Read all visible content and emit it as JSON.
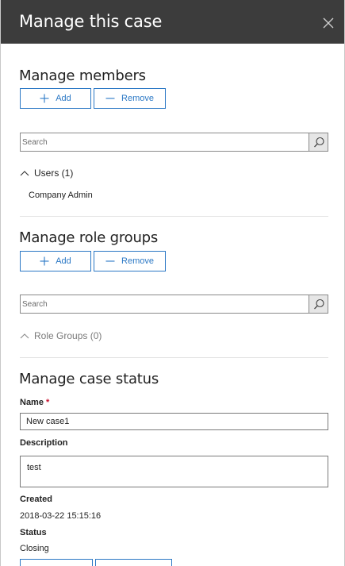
{
  "header": {
    "title": "Manage this case"
  },
  "members": {
    "title": "Manage members",
    "add_label": "Add",
    "remove_label": "Remove",
    "search_placeholder": "Search",
    "users_toggle": "Users (1)",
    "users": [
      "Company Admin"
    ]
  },
  "role_groups": {
    "title": "Manage role groups",
    "add_label": "Add",
    "remove_label": "Remove",
    "search_placeholder": "Search",
    "groups_toggle": "Role Groups (0)"
  },
  "status": {
    "title": "Manage case status",
    "name_label": "Name",
    "required_mark": "*",
    "name_value": "New case1",
    "description_label": "Description",
    "description_value": "test",
    "created_label": "Created",
    "created_value": "2018-03-22 15:15:16",
    "status_label": "Status",
    "status_value": "Closing"
  },
  "colors": {
    "header_bg": "#3c3c3c",
    "accent": "#2b78c5",
    "required": "#c8102e"
  }
}
